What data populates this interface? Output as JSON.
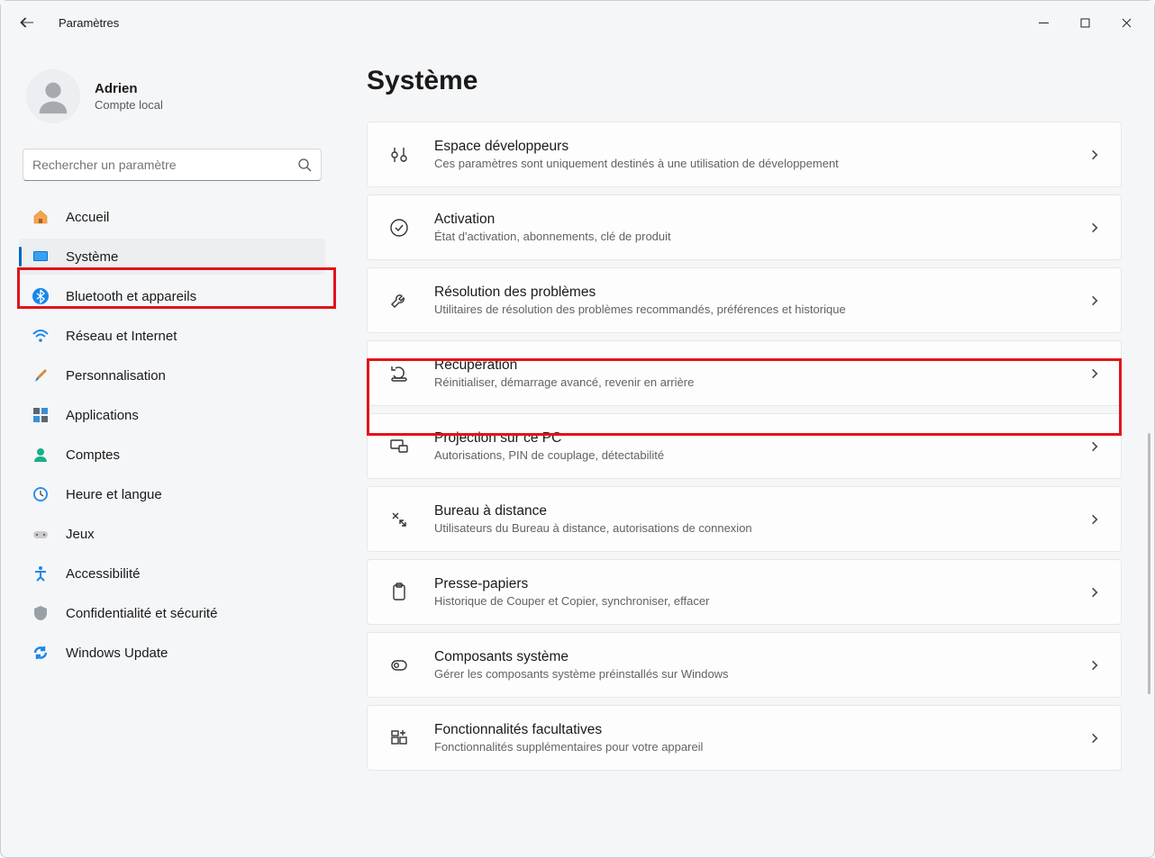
{
  "window": {
    "title": "Paramètres"
  },
  "user": {
    "name": "Adrien",
    "subtitle": "Compte local"
  },
  "search": {
    "placeholder": "Rechercher un paramètre"
  },
  "nav": [
    {
      "id": "accueil",
      "label": "Accueil"
    },
    {
      "id": "systeme",
      "label": "Système"
    },
    {
      "id": "bluetooth",
      "label": "Bluetooth et appareils"
    },
    {
      "id": "reseau",
      "label": "Réseau et Internet"
    },
    {
      "id": "personnalisation",
      "label": "Personnalisation"
    },
    {
      "id": "applications",
      "label": "Applications"
    },
    {
      "id": "comptes",
      "label": "Comptes"
    },
    {
      "id": "heure",
      "label": "Heure et langue"
    },
    {
      "id": "jeux",
      "label": "Jeux"
    },
    {
      "id": "accessibilite",
      "label": "Accessibilité"
    },
    {
      "id": "confidentialite",
      "label": "Confidentialité et sécurité"
    },
    {
      "id": "update",
      "label": "Windows Update"
    }
  ],
  "page": {
    "title": "Système"
  },
  "cards": [
    {
      "id": "developpeurs",
      "title": "Espace développeurs",
      "sub": "Ces paramètres sont uniquement destinés à une utilisation de développement"
    },
    {
      "id": "activation",
      "title": "Activation",
      "sub": "État d'activation, abonnements, clé de produit"
    },
    {
      "id": "resolution",
      "title": "Résolution des problèmes",
      "sub": "Utilitaires de résolution des problèmes recommandés, préférences et historique"
    },
    {
      "id": "recuperation",
      "title": "Récupération",
      "sub": "Réinitialiser, démarrage avancé, revenir en arrière"
    },
    {
      "id": "projection",
      "title": "Projection sur ce PC",
      "sub": "Autorisations, PIN de couplage, détectabilité"
    },
    {
      "id": "bureau",
      "title": "Bureau à distance",
      "sub": "Utilisateurs du Bureau à distance, autorisations de connexion"
    },
    {
      "id": "presse",
      "title": "Presse-papiers",
      "sub": "Historique de Couper et Copier, synchroniser, effacer"
    },
    {
      "id": "composants",
      "title": "Composants système",
      "sub": "Gérer les composants système préinstallés sur Windows"
    },
    {
      "id": "fonctionnalites",
      "title": "Fonctionnalités facultatives",
      "sub": "Fonctionnalités supplémentaires pour votre appareil"
    }
  ],
  "highlights": {
    "nav_active_index": 1,
    "card_highlight_index": 3
  }
}
